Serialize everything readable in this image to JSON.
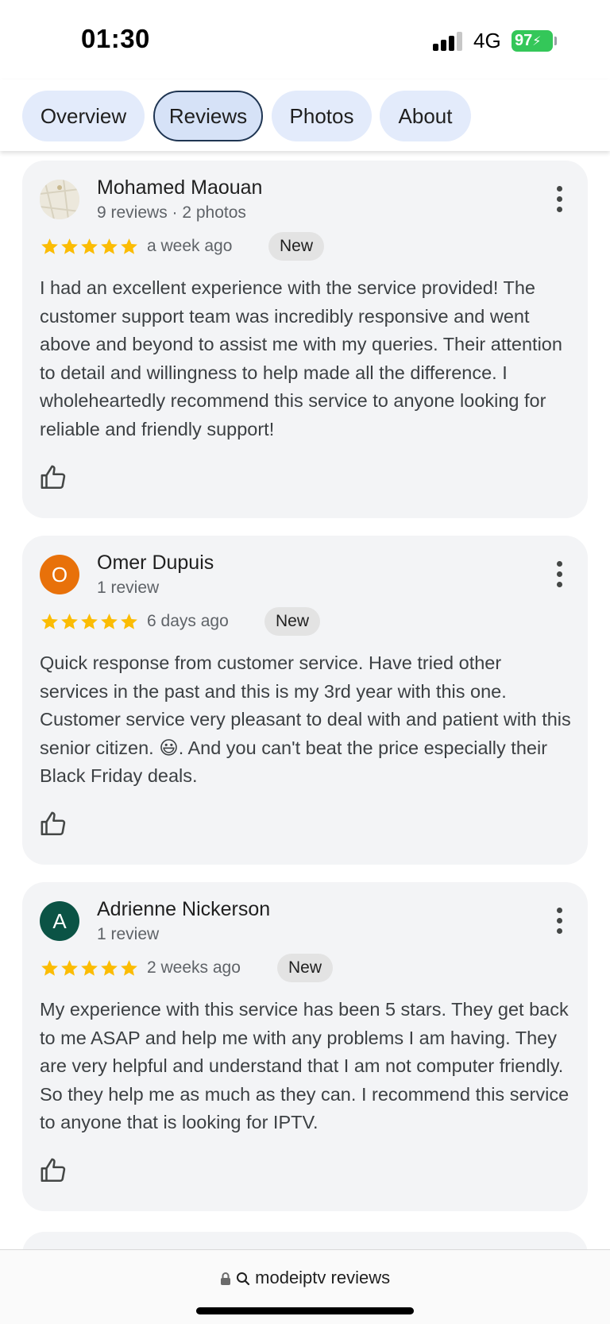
{
  "status_bar": {
    "time": "01:30",
    "network": "4G",
    "battery": "97"
  },
  "tabs": [
    {
      "label": "Overview",
      "active": false
    },
    {
      "label": "Reviews",
      "active": true
    },
    {
      "label": "Photos",
      "active": false
    },
    {
      "label": "About",
      "active": false
    }
  ],
  "reviews": [
    {
      "name": "Mohamed Maouan",
      "meta": "9 reviews · 2 photos",
      "avatar_letter": "",
      "avatar_color": "#e6e3d7",
      "rating": 5,
      "time": "a week ago",
      "badge": "New",
      "text": "I had an excellent experience with the service provided! The customer support team was incredibly responsive and went above and beyond to assist me with my queries. Their attention to detail and willingness to help made all the difference. I wholeheartedly recommend this service to anyone looking for reliable and friendly support!"
    },
    {
      "name": "Omer Dupuis",
      "meta": "1 review",
      "avatar_letter": "O",
      "avatar_color": "#e8710a",
      "rating": 5,
      "time": "6 days ago",
      "badge": "New",
      "text": "Quick response from customer service. Have tried other services in the past and this is my 3rd year with this one. Customer service very pleasant to deal with and patient with this senior citizen. 😃. And you can't beat the price especially their Black Friday deals."
    },
    {
      "name": "Adrienne Nickerson",
      "meta": "1 review",
      "avatar_letter": "A",
      "avatar_color": "#0b5345",
      "rating": 5,
      "time": "2 weeks ago",
      "badge": "New",
      "text": "My experience with this service has been 5 stars. They get back to me ASAP and help me with any problems I am having. They are very helpful and understand that I am not computer friendly. So they help me as much as they can. I recommend this service to anyone that is looking for IPTV."
    }
  ],
  "address_bar": {
    "text": "modeiptv reviews"
  },
  "colors": {
    "star": "#fbbc04",
    "tab_bg": "#e3ebfb",
    "card_bg": "#f3f4f6",
    "battery": "#34c759"
  },
  "icons": [
    "lock-icon",
    "search-icon",
    "thumbs-up-icon",
    "more-vert-icon",
    "star-icon"
  ]
}
